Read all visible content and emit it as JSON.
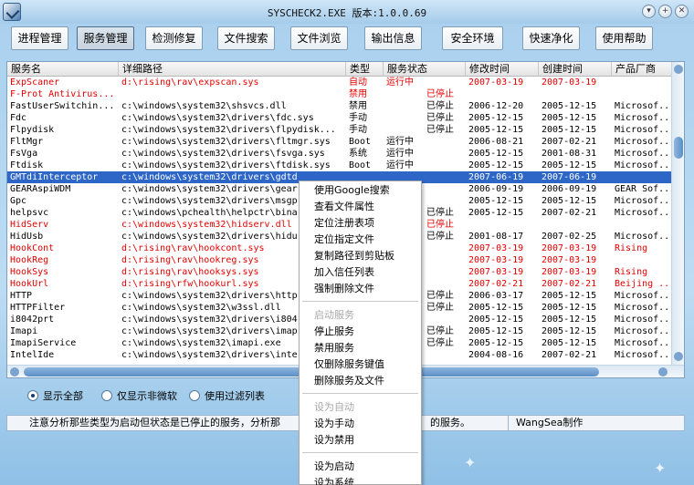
{
  "window": {
    "title": "SYSCHECK2.EXE  版本:1.0.0.69"
  },
  "toolbar": [
    {
      "label": "进程管理"
    },
    {
      "label": "服务管理"
    },
    {
      "label": "检测修复"
    },
    {
      "label": "文件搜索"
    },
    {
      "label": "文件浏览"
    },
    {
      "label": "输出信息"
    },
    {
      "label": "安全环境"
    },
    {
      "label": "快速净化"
    },
    {
      "label": "使用帮助"
    }
  ],
  "active_tab": "服务管理",
  "table": {
    "columns": [
      "服务名",
      "详细路径",
      "类型",
      "服务状态",
      "修改时间",
      "创建时间",
      "产品厂商"
    ],
    "rows": [
      {
        "name": "ExpScaner",
        "path": "d:\\rising\\rav\\expscan.sys",
        "type": "自动",
        "state": "运行中",
        "mtime": "2007-03-19",
        "ctime": "2007-03-19",
        "vendor": "",
        "red": true
      },
      {
        "name": "F-Prot Antivirus...",
        "path": "",
        "type": "禁用",
        "state": "已停止",
        "mtime": "",
        "ctime": "",
        "vendor": "",
        "red": true
      },
      {
        "name": "FastUserSwitchin...",
        "path": "c:\\windows\\system32\\shsvcs.dll",
        "type": "禁用",
        "state": "已停止",
        "mtime": "2006-12-20",
        "ctime": "2005-12-15",
        "vendor": "Microsof..."
      },
      {
        "name": "Fdc",
        "path": "c:\\windows\\system32\\drivers\\fdc.sys",
        "type": "手动",
        "state": "已停止",
        "mtime": "2005-12-15",
        "ctime": "2005-12-15",
        "vendor": "Microsof..."
      },
      {
        "name": "Flpydisk",
        "path": "c:\\windows\\system32\\drivers\\flpydisk...",
        "type": "手动",
        "state": "已停止",
        "mtime": "2005-12-15",
        "ctime": "2005-12-15",
        "vendor": "Microsof..."
      },
      {
        "name": "FltMgr",
        "path": "c:\\windows\\system32\\drivers\\fltmgr.sys",
        "type": "Boot",
        "state": "运行中",
        "mtime": "2006-08-21",
        "ctime": "2007-02-21",
        "vendor": "Microsof..."
      },
      {
        "name": "FsVga",
        "path": "c:\\windows\\system32\\drivers\\fsvga.sys",
        "type": "系统",
        "state": "运行中",
        "mtime": "2005-12-15",
        "ctime": "2001-08-31",
        "vendor": "Microsof..."
      },
      {
        "name": "Ftdisk",
        "path": "c:\\windows\\system32\\drivers\\ftdisk.sys",
        "type": "Boot",
        "state": "运行中",
        "mtime": "2005-12-15",
        "ctime": "2005-12-15",
        "vendor": "Microsof..."
      },
      {
        "name": "GMTdiInterceptor",
        "path": "c:\\windows\\system32\\drivers\\gdtd",
        "type": "",
        "state": "",
        "mtime": "2007-06-19",
        "ctime": "2007-06-19",
        "vendor": "",
        "selected": true
      },
      {
        "name": "GEARAspiWDM",
        "path": "c:\\windows\\system32\\drivers\\gear",
        "type": "",
        "state": "",
        "mtime": "2006-09-19",
        "ctime": "2006-09-19",
        "vendor": "GEAR Sof..."
      },
      {
        "name": "Gpc",
        "path": "c:\\windows\\system32\\drivers\\msgp",
        "type": "",
        "state": "",
        "mtime": "2005-12-15",
        "ctime": "2005-12-15",
        "vendor": "Microsof..."
      },
      {
        "name": "helpsvc",
        "path": "c:\\windows\\pchealth\\helpctr\\bina",
        "type": "",
        "state": "已停止",
        "mtime": "2005-12-15",
        "ctime": "2007-02-21",
        "vendor": "Microsof..."
      },
      {
        "name": "HidServ",
        "path": "c:\\windows\\system32\\hidserv.dll",
        "type": "",
        "state": "已停止",
        "mtime": "",
        "ctime": "",
        "vendor": "",
        "red": true
      },
      {
        "name": "HidUsb",
        "path": "c:\\windows\\system32\\drivers\\hidu",
        "type": "",
        "state": "已停止",
        "mtime": "2001-08-17",
        "ctime": "2007-02-25",
        "vendor": "Microsof..."
      },
      {
        "name": "HookCont",
        "path": "d:\\rising\\rav\\hookcont.sys",
        "type": "",
        "state": "",
        "mtime": "2007-03-19",
        "ctime": "2007-03-19",
        "vendor": "Rising",
        "red": true
      },
      {
        "name": "HookReg",
        "path": "d:\\rising\\rav\\hookreg.sys",
        "type": "",
        "state": "",
        "mtime": "2007-03-19",
        "ctime": "2007-03-19",
        "vendor": "",
        "red": true
      },
      {
        "name": "HookSys",
        "path": "d:\\rising\\rav\\hooksys.sys",
        "type": "",
        "state": "",
        "mtime": "2007-03-19",
        "ctime": "2007-03-19",
        "vendor": "Rising",
        "red": true
      },
      {
        "name": "HookUrl",
        "path": "d:\\rising\\rfw\\hookurl.sys",
        "type": "",
        "state": "",
        "mtime": "2007-02-21",
        "ctime": "2007-02-21",
        "vendor": "Beijing ...",
        "red": true
      },
      {
        "name": "HTTP",
        "path": "c:\\windows\\system32\\drivers\\http",
        "type": "",
        "state": "已停止",
        "mtime": "2006-03-17",
        "ctime": "2005-12-15",
        "vendor": "Microsof..."
      },
      {
        "name": "HTTPFilter",
        "path": "c:\\windows\\system32\\w3ssl.dll",
        "type": "",
        "state": "已停止",
        "mtime": "2005-12-15",
        "ctime": "2005-12-15",
        "vendor": "Microsof..."
      },
      {
        "name": "i8042prt",
        "path": "c:\\windows\\system32\\drivers\\i804",
        "type": "",
        "state": "",
        "mtime": "2005-12-15",
        "ctime": "2005-12-15",
        "vendor": "Microsof..."
      },
      {
        "name": "Imapi",
        "path": "c:\\windows\\system32\\drivers\\imap",
        "type": "",
        "state": "已停止",
        "mtime": "2005-12-15",
        "ctime": "2005-12-15",
        "vendor": "Microsof..."
      },
      {
        "name": "ImapiService",
        "path": "c:\\windows\\system32\\imapi.exe",
        "type": "",
        "state": "已停止",
        "mtime": "2005-12-15",
        "ctime": "2005-12-15",
        "vendor": "Microsof..."
      },
      {
        "name": "IntelIde",
        "path": "c:\\windows\\system32\\drivers\\inte",
        "type": "",
        "state": "",
        "mtime": "2004-08-16",
        "ctime": "2007-02-21",
        "vendor": "Microsof..."
      }
    ]
  },
  "filters": [
    {
      "label": "显示全部",
      "checked": true
    },
    {
      "label": "仅显示非微软",
      "checked": false
    },
    {
      "label": "使用过滤列表",
      "checked": false
    }
  ],
  "status": {
    "message": "注意分析那些类型为启动但状态是已停止的服务，分析那",
    "message_tail": "的服务。",
    "author": "WangSea制作"
  },
  "context_menu": {
    "groups": [
      [
        {
          "label": "使用Google搜索",
          "enabled": true
        },
        {
          "label": "查看文件属性",
          "enabled": true
        },
        {
          "label": "定位注册表项",
          "enabled": true
        },
        {
          "label": "定位指定文件",
          "enabled": true
        },
        {
          "label": "复制路径到剪贴板",
          "enabled": true
        },
        {
          "label": "加入信任列表",
          "enabled": true
        },
        {
          "label": "强制删除文件",
          "enabled": true
        }
      ],
      [
        {
          "label": "启动服务",
          "enabled": false
        },
        {
          "label": "停止服务",
          "enabled": true
        },
        {
          "label": "禁用服务",
          "enabled": true
        },
        {
          "label": "仅删除服务键值",
          "enabled": true
        },
        {
          "label": "删除服务及文件",
          "enabled": true
        }
      ],
      [
        {
          "label": "设为自动",
          "enabled": false
        },
        {
          "label": "设为手动",
          "enabled": true
        },
        {
          "label": "设为禁用",
          "enabled": true
        }
      ],
      [
        {
          "label": "设为启动",
          "enabled": true
        },
        {
          "label": "设为系统",
          "enabled": true
        }
      ]
    ]
  },
  "colors": {
    "accent": "#2d66c6",
    "warning_red": "#e40000",
    "window_bg": "#bcdcf3"
  }
}
